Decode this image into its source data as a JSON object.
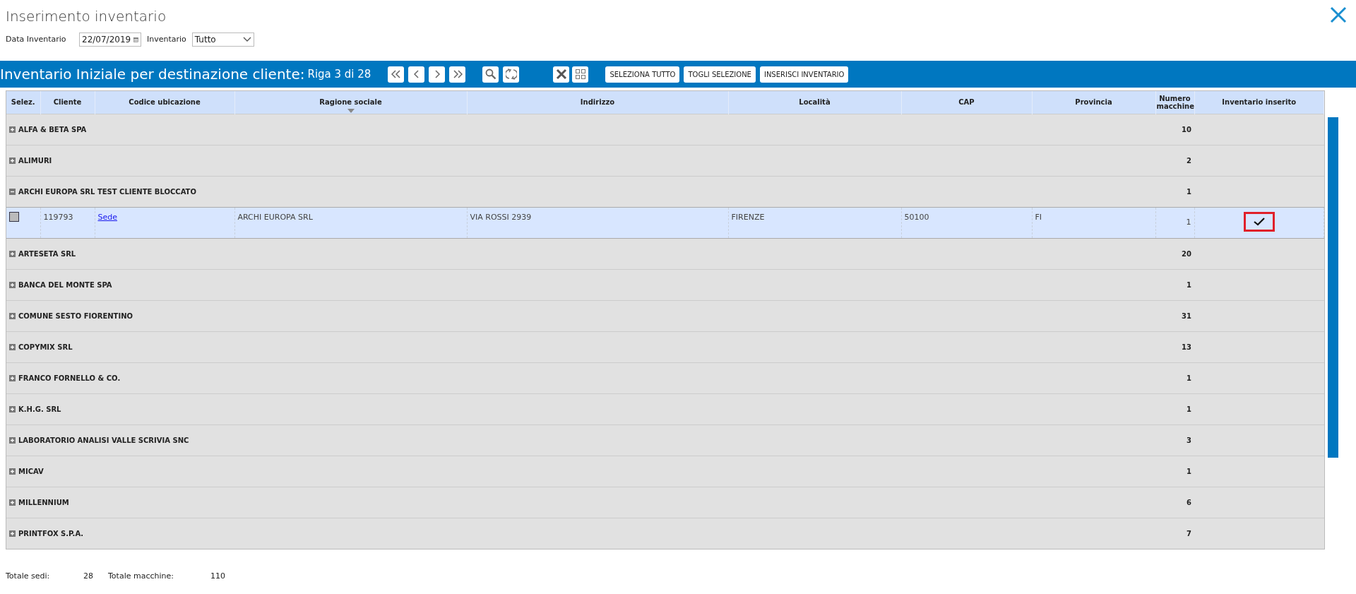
{
  "title": "Inserimento inventario",
  "filters": {
    "date_label": "Data Inventario",
    "date_value": "22/07/2019",
    "type_label": "Inventario",
    "type_value": "Tutto"
  },
  "toolbar": {
    "title": "Inventario Iniziale per destinazione cliente:",
    "position": "Riga 3 di 28",
    "buttons": [
      "SELEZIONA TUTTO",
      "TOGLI SELEZIONE",
      "INSERISCI INVENTARIO"
    ]
  },
  "table": {
    "columns": [
      {
        "label": "Selez.",
        "sorted": false
      },
      {
        "label": "Cliente",
        "sorted": false
      },
      {
        "label": "Codice ubicazione",
        "sorted": false
      },
      {
        "label": "Ragione sociale",
        "sorted": true
      },
      {
        "label": "Indirizzo",
        "sorted": false
      },
      {
        "label": "Località",
        "sorted": false
      },
      {
        "label": "CAP",
        "sorted": false
      },
      {
        "label": "Provincia",
        "sorted": false
      },
      {
        "label": "Numero macchine",
        "sorted": false
      },
      {
        "label": "Inventario inserito",
        "sorted": false
      }
    ],
    "groups": [
      {
        "name": "ALFA & BETA SPA",
        "count": "10",
        "expanded": false
      },
      {
        "name": "ALIMURI",
        "count": "2",
        "expanded": false
      },
      {
        "name": "ARCHI EUROPA SRL TEST CLIENTE BLOCCATO",
        "count": "1",
        "expanded": true,
        "rows": [
          {
            "checked": false,
            "cliente": "119793",
            "codice": "Sede",
            "ragione": "ARCHI EUROPA SRL",
            "indirizzo": "VIA ROSSI 2939",
            "localita": "FIRENZE",
            "cap": "50100",
            "provincia": "FI",
            "numero": "1",
            "inserito": true,
            "highlighted": true
          }
        ]
      },
      {
        "name": "ARTESETA SRL",
        "count": "20",
        "expanded": false
      },
      {
        "name": "BANCA DEL MONTE SPA",
        "count": "1",
        "expanded": false
      },
      {
        "name": "COMUNE SESTO FIORENTINO",
        "count": "31",
        "expanded": false
      },
      {
        "name": "COPYMIX SRL",
        "count": "13",
        "expanded": false
      },
      {
        "name": "FRANCO FORNELLO & CO.",
        "count": "1",
        "expanded": false
      },
      {
        "name": "K.H.G. SRL",
        "count": "1",
        "expanded": false
      },
      {
        "name": "LABORATORIO ANALISI VALLE SCRIVIA SNC",
        "count": "3",
        "expanded": false
      },
      {
        "name": "MICAV",
        "count": "1",
        "expanded": false
      },
      {
        "name": "MILLENNIUM",
        "count": "6",
        "expanded": false
      },
      {
        "name": "PRINTFOX S.P.A.",
        "count": "7",
        "expanded": false
      }
    ]
  },
  "footer": {
    "sedi_label": "Totale sedi:",
    "sedi_value": "28",
    "macchine_label": "Totale macchine:",
    "macchine_value": "110"
  }
}
